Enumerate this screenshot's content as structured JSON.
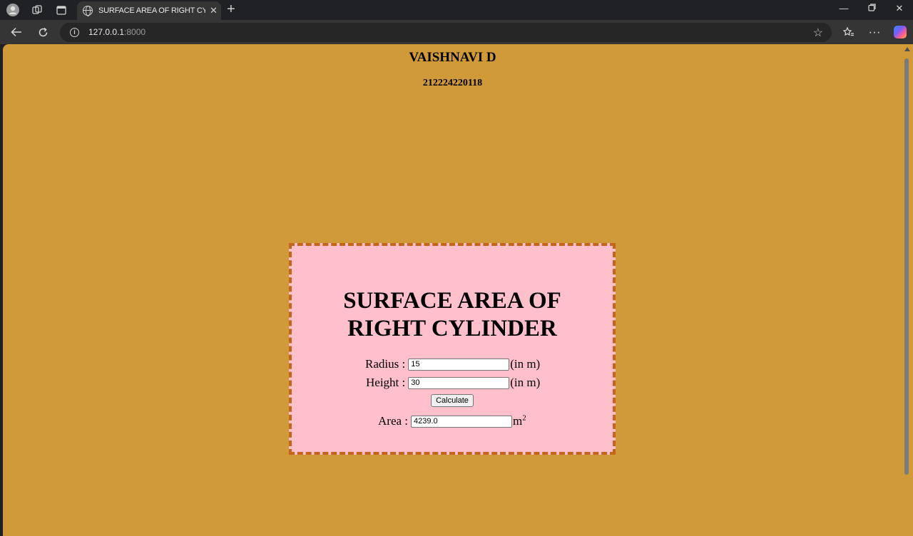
{
  "browser": {
    "tab_title": "SURFACE AREA OF RIGHT CYLIND",
    "url_host": "127.0.0.1",
    "url_port": ":8000"
  },
  "page": {
    "student_name": "VAISHNAVI D",
    "student_id": "212224220118",
    "title_line1": "SURFACE AREA OF",
    "title_line2": "RIGHT CYLINDER",
    "radius_label": "Radius :",
    "radius_value": "15",
    "radius_unit": "(in m)",
    "height_label": "Height :",
    "height_value": "30",
    "height_unit": "(in m)",
    "calculate_label": "Calculate",
    "area_label": "Area :",
    "area_value": "4239.0",
    "area_unit": "m",
    "area_unit_exp": "2"
  },
  "colors": {
    "page_background": "#d09a38",
    "card_background": "#ffc0cb",
    "card_border": "#c5651c"
  }
}
